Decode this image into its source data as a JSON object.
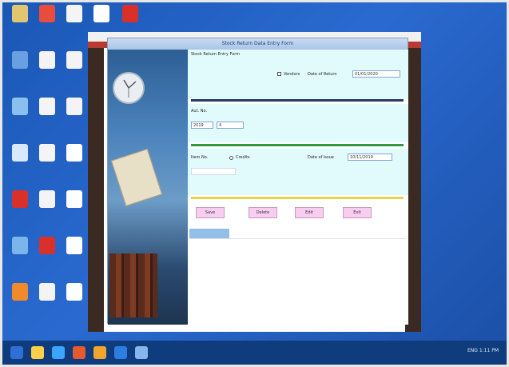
{
  "colors": {
    "desktop": "#1f5cbd",
    "taskbar": "#0f3c7d",
    "app_title": "#b8d1ef",
    "band": "#e1fbfc",
    "rule_blue": "#283a6a",
    "rule_green": "#2e9a3d",
    "rule_yellow": "#e6d54a",
    "button": "#f8cdf0"
  },
  "desktop": {
    "icons": [
      {
        "name": "Computer",
        "color": "#e0c66e"
      },
      {
        "name": "Google Chrome",
        "color": "#e74c3c"
      },
      {
        "name": "Documents",
        "color": "#f4f4f4"
      },
      {
        "name": "Flag",
        "color": "#ffffff"
      },
      {
        "name": "PDF",
        "color": "#d9302a"
      },
      {
        "name": "Network",
        "color": "#69a0e0"
      },
      {
        "name": "Documents",
        "color": "#f4f4f4"
      },
      {
        "name": "Documents",
        "color": "#f4f4f4"
      },
      {
        "name": "Recycle Bin",
        "color": "#89c0f0"
      },
      {
        "name": "Documents",
        "color": "#f4f4f4"
      },
      {
        "name": "Documents",
        "color": "#f4f4f4"
      },
      {
        "name": "Recycle Bin",
        "color": "#d8e9ff"
      },
      {
        "name": "Documents",
        "color": "#f4f4f4"
      },
      {
        "name": "Window",
        "color": "#ffffff"
      },
      {
        "name": "PDF",
        "color": "#d9302a"
      },
      {
        "name": "Documents",
        "color": "#f4f4f4"
      },
      {
        "name": "Window",
        "color": "#ffffff"
      },
      {
        "name": "Internet",
        "color": "#7ab6ea"
      },
      {
        "name": "PDF",
        "color": "#d9302a"
      },
      {
        "name": "Window",
        "color": "#ffffff"
      },
      {
        "name": "Firefox",
        "color": "#f08a2a"
      },
      {
        "name": "Documents",
        "color": "#f4f4f4"
      },
      {
        "name": "Window",
        "color": "#ffffff"
      }
    ]
  },
  "taskbar": {
    "icons": [
      "start-icon",
      "store-icon",
      "files-icon",
      "media-icon",
      "chrome-icon",
      "ie-icon",
      "app-icon"
    ],
    "tray_text": "ENG  1:11 PM"
  },
  "app": {
    "title": "Stock Return Data Entry Form",
    "header_label": "Stock Return Entry Form",
    "checkbox_label": "Vendors",
    "date_label": "Date of Return",
    "date_value": "01/01/2020",
    "section_label": "Aut. No.",
    "aut_prefix": "2019",
    "aut_value": "4",
    "item_label": "Item No.",
    "radio_label": "Credits",
    "date_issue_label": "Date of Issue",
    "date_issue_value": "10/11/2019",
    "buttons": [
      "Save",
      "Delete",
      "Edit",
      "Exit"
    ]
  }
}
